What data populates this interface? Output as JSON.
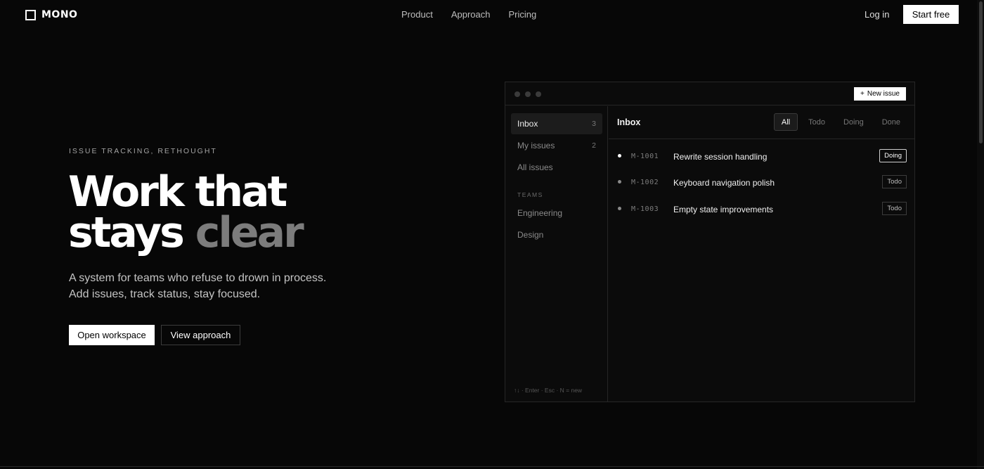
{
  "header": {
    "logo_text": "MONO",
    "nav": [
      "Product",
      "Approach",
      "Pricing"
    ],
    "login_label": "Log in",
    "cta_label": "Start free"
  },
  "hero": {
    "eyebrow": "ISSUE TRACKING, RETHOUGHT",
    "headline_line1": "Work that",
    "headline_line2_a": "stays",
    "headline_line2_b": "clear",
    "subtext_line1": "A system for teams who refuse to drown in process.",
    "subtext_line2": "Add issues, track status, stay focused.",
    "primary_label": "Open workspace",
    "secondary_label": "View approach"
  },
  "app": {
    "new_issue_label": "New issue",
    "new_issue_icon": "plus-icon",
    "sidebar": {
      "items": [
        {
          "label": "Inbox",
          "count": "3"
        },
        {
          "label": "My issues",
          "count": "2"
        },
        {
          "label": "All issues",
          "count": ""
        }
      ],
      "section_label": "TEAMS",
      "teams": [
        "Engineering",
        "Design"
      ],
      "shortcuts": "↑↓ · Enter · Esc · N = new"
    },
    "main": {
      "title": "Inbox",
      "tabs": [
        "All",
        "Todo",
        "Doing",
        "Done"
      ],
      "active_tab": "All",
      "issues": [
        {
          "id": "M-1001",
          "title": "Rewrite session handling",
          "status": "Doing"
        },
        {
          "id": "M-1002",
          "title": "Keyboard navigation polish",
          "status": "Todo"
        },
        {
          "id": "M-1003",
          "title": "Empty state improvements",
          "status": "Todo"
        }
      ]
    }
  },
  "colors": {
    "background": "#070707",
    "panel": "#0b0b0b",
    "border": "#262626",
    "muted_text": "#7c7c7c",
    "accent": "#ffffff"
  }
}
